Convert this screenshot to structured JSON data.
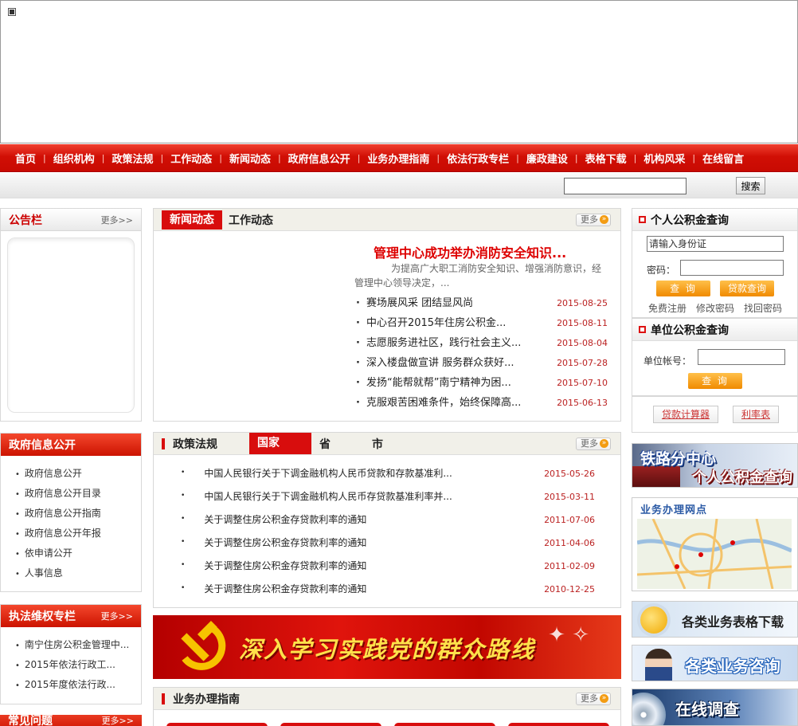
{
  "nav": [
    "首页",
    "组织机构",
    "政策法规",
    "工作动态",
    "新闻动态",
    "政府信息公开",
    "业务办理指南",
    "依法行政专栏",
    "廉政建设",
    "表格下载",
    "机构风采",
    "在线留言"
  ],
  "search": {
    "button": "搜索"
  },
  "notice": {
    "title": "公告栏",
    "more": "更多>>"
  },
  "gov_info": {
    "title": "政府信息公开",
    "items": [
      "政府信息公开",
      "政府信息公开目录",
      "政府信息公开指南",
      "政府信息公开年报",
      "依申请公开",
      "人事信息"
    ]
  },
  "law": {
    "title": "执法维权专栏",
    "more": "更多>>",
    "items": [
      "南宁住房公积金管理中...",
      "2015年依法行政工...",
      "2015年度依法行政..."
    ]
  },
  "faq": {
    "title": "常见问题",
    "more": "更多>>"
  },
  "news": {
    "tab_active": "新闻动态",
    "tab_other": "工作动态",
    "more": "更多",
    "headline": "管理中心成功举办消防安全知识...",
    "summary": "为提高广大职工消防安全知识、增强消防意识，经管理中心领导决定，...",
    "items": [
      {
        "title": "赛场展风采 团结显风尚",
        "date": "2015-08-25"
      },
      {
        "title": "中心召开2015年住房公积金...",
        "date": "2015-08-11"
      },
      {
        "title": "志愿服务进社区，践行社会主义...",
        "date": "2015-08-04"
      },
      {
        "title": "深入楼盘做宣讲 服务群众获好...",
        "date": "2015-07-28"
      },
      {
        "title": "发扬“能帮就帮”南宁精神为困...",
        "date": "2015-07-10"
      },
      {
        "title": "克服艰苦困难条件，始终保障高...",
        "date": "2015-06-13"
      }
    ]
  },
  "policy": {
    "title": "政策法规",
    "tabs": [
      "国家",
      "省",
      "市"
    ],
    "more": "更多",
    "items": [
      {
        "title": "中国人民银行关于下调金融机构人民币贷款和存款基准利...",
        "date": "2015-05-26"
      },
      {
        "title": "中国人民银行关于下调金融机构人民币存贷款基准利率并...",
        "date": "2015-03-11"
      },
      {
        "title": "关于调整住房公积金存贷款利率的通知",
        "date": "2011-07-06"
      },
      {
        "title": "关于调整住房公积金存贷款利率的通知",
        "date": "2011-04-06"
      },
      {
        "title": "关于调整住房公积金存贷款利率的通知",
        "date": "2011-02-09"
      },
      {
        "title": "关于调整住房公积金存贷款利率的通知",
        "date": "2010-12-25"
      }
    ]
  },
  "party_banner": {
    "slogan": "深入学习实践党的群众路线"
  },
  "guide": {
    "title": "业务办理指南",
    "more": "更多"
  },
  "personal": {
    "title": "个人公积金查询",
    "id_placeholder": "请输入身份证",
    "password_label": "密码：",
    "query": "查 询",
    "loan_query": "贷款查询",
    "links": [
      "免费注册",
      "修改密码",
      "找回密码"
    ]
  },
  "unit": {
    "title": "单位公积金查询",
    "account_label": "单位帐号：",
    "query": "查 询"
  },
  "tools": {
    "calculator": "贷款计算器",
    "rates": "利率表"
  },
  "promos": {
    "railway_line1": "铁路分中心",
    "railway_line2": "个人公积金查询",
    "outlets": "业务办理网点",
    "forms": "各类业务表格下载",
    "consult": "各类业务咨询",
    "survey": "在线调查"
  },
  "colors": {
    "brand_red": "#d80d0d",
    "orange": "#f08a00"
  }
}
